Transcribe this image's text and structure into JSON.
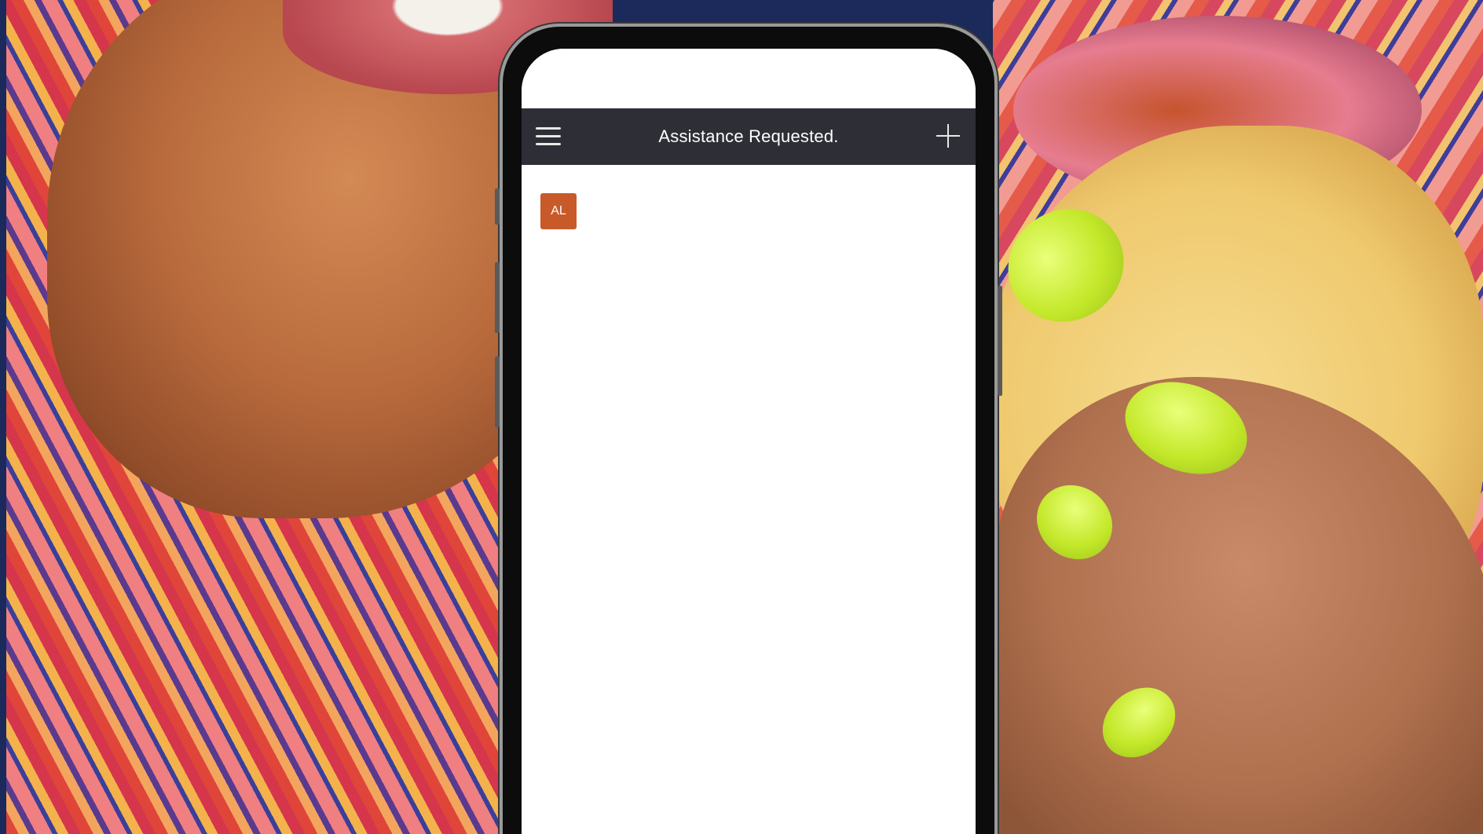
{
  "app_bar": {
    "title": "Assistance Requested.",
    "menu_icon": "hamburger-menu-icon",
    "add_icon": "plus-icon"
  },
  "user": {
    "avatar_initials": "AL",
    "avatar_color": "#c85a2a"
  },
  "colors": {
    "app_bar": "#2e2f36",
    "screen": "#ffffff",
    "nail_accent": "#c4e82a"
  }
}
